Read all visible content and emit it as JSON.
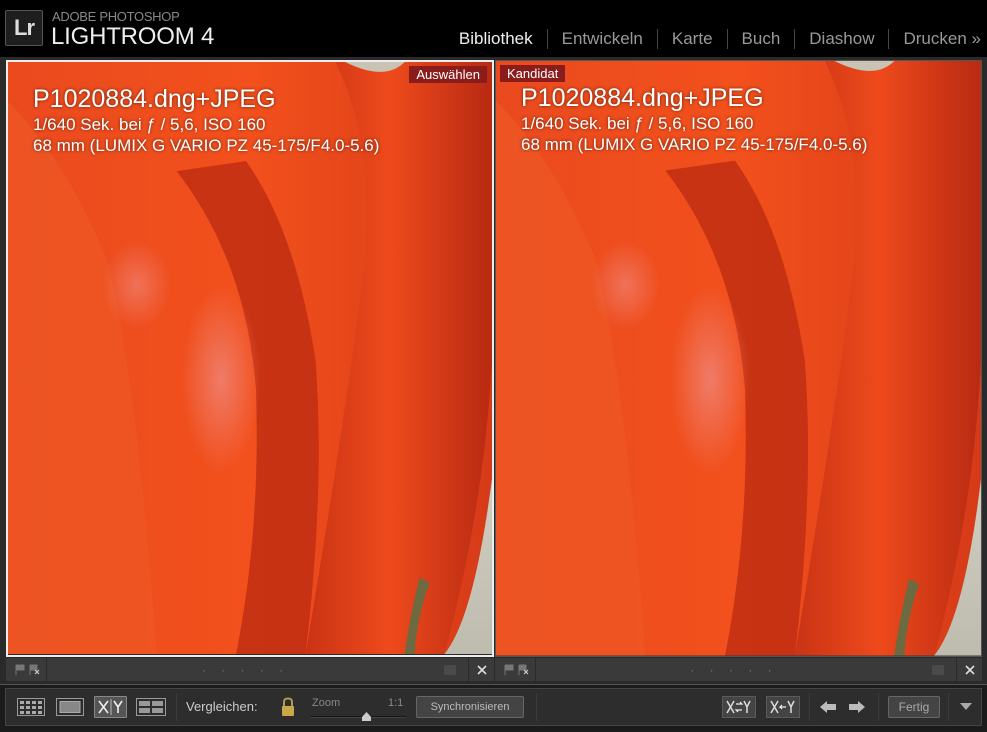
{
  "app": {
    "logo_text": "Lr",
    "brand_top": "ADOBE PHOTOSHOP",
    "brand_main": "LIGHTROOM 4"
  },
  "modules": [
    {
      "label": "Bibliothek",
      "active": true
    },
    {
      "label": "Entwickeln",
      "active": false
    },
    {
      "label": "Karte",
      "active": false
    },
    {
      "label": "Buch",
      "active": false
    },
    {
      "label": "Diashow",
      "active": false
    },
    {
      "label": "Drucken",
      "active": false
    }
  ],
  "modules_more": "»",
  "panes": {
    "left": {
      "tag": "Auswählen",
      "filename": "P1020884.dng+JPEG",
      "exposure": "1/640 Sek. bei ƒ / 5,6, ISO 160",
      "lens": "68 mm (LUMIX G VARIO PZ 45-175/F4.0-5.6)"
    },
    "right": {
      "tag": "Kandidat",
      "filename": "P1020884.dng+JPEG",
      "exposure": "1/640 Sek. bei ƒ / 5,6, ISO 160",
      "lens": "68 mm (LUMIX G VARIO PZ 45-175/F4.0-5.6)"
    }
  },
  "rating_placeholder": "· · · · ·",
  "toolbar": {
    "compare_label": "Vergleichen:",
    "zoom_label": "Zoom",
    "zoom_ratio": "1:1",
    "zoom_level": 0.6,
    "sync_label": "Synchronisieren",
    "done_label": "Fertig"
  },
  "colors": {
    "accent_tag": "#8a1c1c",
    "petal": "#e8401a",
    "background": "#2a2a2a"
  },
  "icons": [
    "grid-view-icon",
    "loupe-view-icon",
    "compare-view-icon",
    "survey-view-icon",
    "lock-icon",
    "swap-icon",
    "make-select-icon",
    "arrow-left-icon",
    "arrow-right-icon",
    "flag-icon",
    "close-icon",
    "chevron-down-icon"
  ]
}
